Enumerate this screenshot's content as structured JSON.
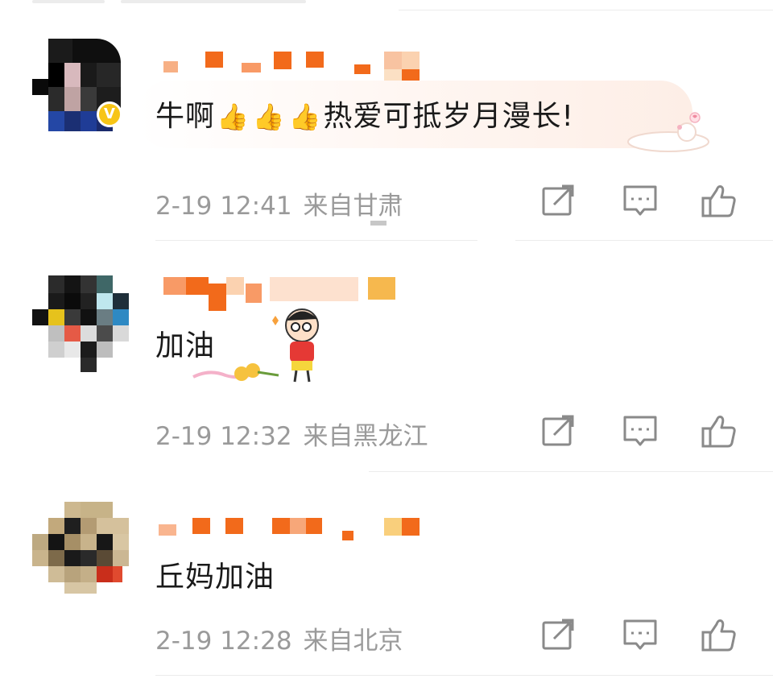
{
  "comments": [
    {
      "text_before": "牛啊",
      "emoji": "👍",
      "emoji_count": 3,
      "text_after": "热爱可抵岁月漫长!",
      "date_time": "2-19 12:41",
      "location": "来自甘肃",
      "verified_badge": "V"
    },
    {
      "text": "加油",
      "date_time": "2-19 12:32",
      "location": "来自黑龙江"
    },
    {
      "text": "丘妈加油",
      "date_time": "2-19 12:28",
      "location": "来自北京"
    }
  ],
  "icons": {
    "forward": "forward-icon",
    "reply": "comment-icon",
    "like": "thumbs-up-icon"
  },
  "colors": {
    "username_pixel": "#f26a1b",
    "meta_text": "#9a9a9a",
    "comment_text": "#1a1a1a",
    "verified": "#f7c517",
    "icon": "#8a8a8a"
  }
}
